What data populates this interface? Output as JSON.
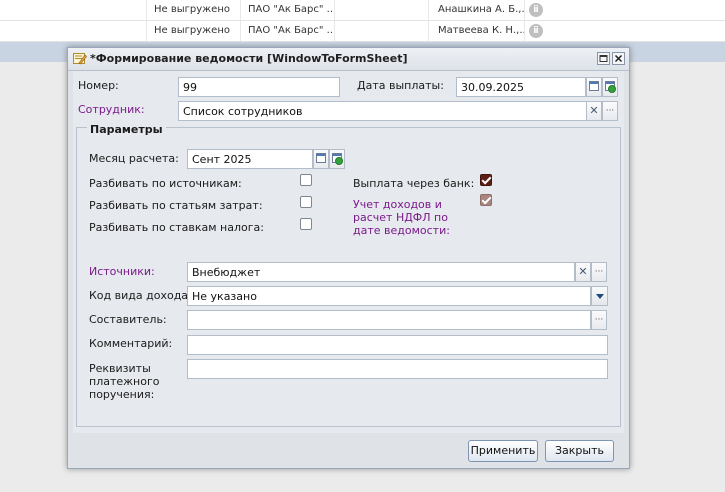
{
  "background_rows": [
    {
      "status": "Не выгружено",
      "bank": "ПАО \"Ак Барс\" ...",
      "employee": "Анашкина А. Б.,..."
    },
    {
      "status": "Не выгружено",
      "bank": "ПАО \"Ак Барс\" ...",
      "employee": "Матвеева К. Н.,..."
    }
  ],
  "window": {
    "title": "*Формирование ведомости [WindowToFormSheet]"
  },
  "form": {
    "number_label": "Номер:",
    "number_value": "99",
    "pay_date_label": "Дата выплаты:",
    "pay_date_value": "30.09.2025",
    "employee_label": "Сотрудник:",
    "employee_value": "Список сотрудников",
    "params_legend": "Параметры",
    "month_label": "Месяц расчета:",
    "month_value": "Сент 2025",
    "split_sources_label": "Разбивать по источникам:",
    "split_items_label": "Разбивать по статьям затрат:",
    "split_tax_label": "Разбивать по ставкам налога:",
    "bank_payment_label": "Выплата через банк:",
    "ndfl_label_1": "Учет доходов и",
    "ndfl_label_2": "расчет НДФЛ по",
    "ndfl_label_3": "дате ведомости:",
    "sources_label": "Источники:",
    "sources_value": "Внебюджет",
    "income_code_label": "Код вида дохода:",
    "income_code_value": "Не указано",
    "author_label": "Составитель:",
    "author_value": "",
    "comment_label": "Комментарий:",
    "comment_value": "",
    "requisites_label_1": "Реквизиты",
    "requisites_label_2": "платежного",
    "requisites_label_3": "поручения:",
    "requisites_value": ""
  },
  "checkboxes": {
    "split_sources": false,
    "split_items": false,
    "split_tax": false,
    "bank_payment": true,
    "ndfl_by_date": true
  },
  "buttons": {
    "apply": "Применить",
    "close": "Закрыть"
  },
  "colors": {
    "purple_label": "#7a1a8a",
    "checkbox_checked": "#5c1f14"
  }
}
